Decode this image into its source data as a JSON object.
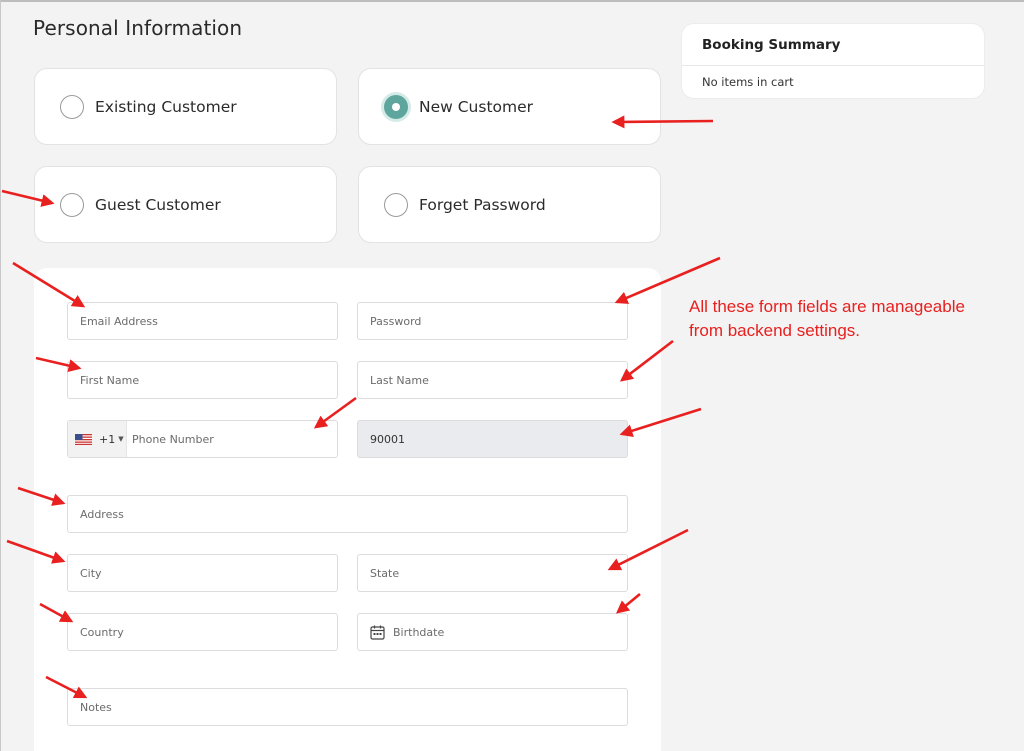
{
  "page": {
    "title": "Personal Information"
  },
  "customer_options": [
    {
      "label": "Existing Customer",
      "checked": false
    },
    {
      "label": "New Customer",
      "checked": true
    },
    {
      "label": "Guest Customer",
      "checked": false
    },
    {
      "label": "Forget Password",
      "checked": false
    }
  ],
  "booking_summary": {
    "title": "Booking Summary",
    "empty_text": "No items in cart"
  },
  "form": {
    "email_placeholder": "Email Address",
    "password_placeholder": "Password",
    "first_name_placeholder": "First Name",
    "last_name_placeholder": "Last Name",
    "phone": {
      "dial_code": "+1",
      "country_flag": "us-flag-icon",
      "placeholder": "Phone Number"
    },
    "zip_value": "90001",
    "address_placeholder": "Address",
    "city_placeholder": "City",
    "state_placeholder": "State",
    "country_placeholder": "Country",
    "birthdate_placeholder": "Birthdate",
    "notes_placeholder": "Notes"
  },
  "annotation": {
    "line1": "All these form fields are manageable",
    "line2": "from backend settings.",
    "color": "#e8201f"
  },
  "colors": {
    "accent": "#5ea59d",
    "background": "#f3f3f3",
    "annotation": "#e8201f"
  }
}
